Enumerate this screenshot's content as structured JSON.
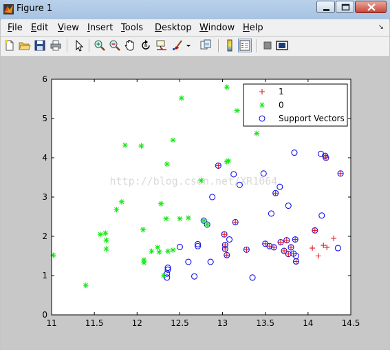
{
  "window": {
    "title": "Figure 1",
    "controls": {
      "minimize": "minimize",
      "maximize": "maximize",
      "close": "close"
    }
  },
  "menu": {
    "items": [
      {
        "label": "File",
        "mnemonic": "F"
      },
      {
        "label": "Edit",
        "mnemonic": "E"
      },
      {
        "label": "View",
        "mnemonic": "V"
      },
      {
        "label": "Insert",
        "mnemonic": "I"
      },
      {
        "label": "Tools",
        "mnemonic": "T"
      },
      {
        "label": "Desktop",
        "mnemonic": "D"
      },
      {
        "label": "Window",
        "mnemonic": "W"
      },
      {
        "label": "Help",
        "mnemonic": "H"
      }
    ],
    "dock_icon": "↘"
  },
  "toolbar": {
    "icons": [
      "new-figure-icon",
      "open-file-icon",
      "save-icon",
      "print-icon",
      "edit-plot-icon",
      "zoom-in-icon",
      "zoom-out-icon",
      "pan-icon",
      "rotate-3d-icon",
      "data-cursor-icon",
      "brush-icon",
      "brush-dropdown-icon",
      "link-plot-icon",
      "insert-colorbar-icon",
      "insert-legend-icon",
      "hide-plot-tools-icon",
      "show-plot-tools-icon"
    ]
  },
  "watermark": "http://blog.csdn.net/XR1064",
  "chart_data": {
    "type": "scatter",
    "xlim": [
      11,
      14.5
    ],
    "ylim": [
      0,
      6
    ],
    "xticks": [
      "11",
      "11.5",
      "12",
      "12.5",
      "13",
      "13.5",
      "14",
      "14.5"
    ],
    "yticks": [
      "0",
      "1",
      "2",
      "3",
      "4",
      "5",
      "6"
    ],
    "grid": false,
    "legend_placement": "top-right",
    "series": [
      {
        "name": "1",
        "marker": "plus",
        "color": "#e8141b",
        "points": [
          [
            12.95,
            3.8
          ],
          [
            13.02,
            2.05
          ],
          [
            13.03,
            1.78
          ],
          [
            13.03,
            1.68
          ],
          [
            13.05,
            1.52
          ],
          [
            13.15,
            2.36
          ],
          [
            13.28,
            1.66
          ],
          [
            13.5,
            1.81
          ],
          [
            13.55,
            1.75
          ],
          [
            13.6,
            1.72
          ],
          [
            13.62,
            3.1
          ],
          [
            13.68,
            1.85
          ],
          [
            13.72,
            1.63
          ],
          [
            13.75,
            1.9
          ],
          [
            13.77,
            1.55
          ],
          [
            13.8,
            1.72
          ],
          [
            13.83,
            1.56
          ],
          [
            13.85,
            1.92
          ],
          [
            13.86,
            1.36
          ],
          [
            14.05,
            1.7
          ],
          [
            14.08,
            2.15
          ],
          [
            14.12,
            1.5
          ],
          [
            14.18,
            1.77
          ],
          [
            14.2,
            4.05
          ],
          [
            14.22,
            1.72
          ],
          [
            14.3,
            1.95
          ],
          [
            14.38,
            3.6
          ],
          [
            14.21,
            4.0
          ]
        ]
      },
      {
        "name": "0",
        "marker": "star",
        "color": "#18e818",
        "points": [
          [
            11.02,
            1.52
          ],
          [
            11.4,
            0.75
          ],
          [
            11.57,
            2.05
          ],
          [
            11.63,
            2.08
          ],
          [
            11.64,
            1.9
          ],
          [
            11.64,
            1.68
          ],
          [
            11.76,
            2.68
          ],
          [
            11.82,
            2.88
          ],
          [
            11.86,
            4.32
          ],
          [
            12.05,
            4.3
          ],
          [
            12.07,
            2.17
          ],
          [
            12.08,
            1.4
          ],
          [
            12.08,
            1.33
          ],
          [
            12.17,
            1.62
          ],
          [
            12.24,
            1.72
          ],
          [
            12.26,
            1.6
          ],
          [
            12.28,
            2.83
          ],
          [
            12.31,
            1.0
          ],
          [
            12.34,
            2.45
          ],
          [
            12.35,
            3.84
          ],
          [
            12.36,
            1.62
          ],
          [
            12.42,
            4.45
          ],
          [
            12.42,
            1.65
          ],
          [
            12.5,
            2.45
          ],
          [
            12.52,
            5.52
          ],
          [
            12.6,
            2.47
          ],
          [
            12.75,
            3.42
          ],
          [
            12.78,
            2.4
          ],
          [
            12.82,
            2.3
          ],
          [
            13.05,
            5.8
          ],
          [
            13.05,
            3.9
          ],
          [
            13.07,
            3.92
          ],
          [
            13.17,
            5.2
          ],
          [
            13.4,
            4.62
          ]
        ]
      },
      {
        "name": "Support Vectors",
        "marker": "circle",
        "color": "#1010f0",
        "points": [
          [
            12.35,
            0.95
          ],
          [
            12.35,
            1.05
          ],
          [
            12.36,
            1.15
          ],
          [
            12.36,
            1.2
          ],
          [
            12.5,
            1.73
          ],
          [
            12.6,
            1.35
          ],
          [
            12.67,
            0.98
          ],
          [
            12.71,
            1.8
          ],
          [
            12.71,
            1.75
          ],
          [
            12.78,
            2.4
          ],
          [
            12.82,
            2.3
          ],
          [
            12.86,
            1.35
          ],
          [
            12.88,
            3.0
          ],
          [
            12.95,
            3.8
          ],
          [
            13.02,
            2.05
          ],
          [
            13.03,
            1.78
          ],
          [
            13.03,
            1.68
          ],
          [
            13.05,
            1.52
          ],
          [
            13.08,
            1.92
          ],
          [
            13.13,
            3.58
          ],
          [
            13.15,
            2.36
          ],
          [
            13.2,
            3.31
          ],
          [
            13.28,
            1.66
          ],
          [
            13.35,
            0.95
          ],
          [
            13.48,
            3.6
          ],
          [
            13.5,
            1.81
          ],
          [
            13.55,
            1.75
          ],
          [
            13.57,
            2.58
          ],
          [
            13.6,
            1.72
          ],
          [
            13.62,
            3.1
          ],
          [
            13.67,
            3.26
          ],
          [
            13.68,
            1.85
          ],
          [
            13.72,
            1.63
          ],
          [
            13.75,
            1.9
          ],
          [
            13.77,
            1.55
          ],
          [
            13.77,
            2.78
          ],
          [
            13.8,
            1.72
          ],
          [
            13.83,
            1.56
          ],
          [
            13.84,
            4.13
          ],
          [
            13.85,
            1.92
          ],
          [
            13.86,
            1.36
          ],
          [
            13.86,
            1.5
          ],
          [
            14.08,
            2.15
          ],
          [
            14.15,
            4.1
          ],
          [
            14.16,
            2.53
          ],
          [
            14.2,
            4.05
          ],
          [
            14.21,
            4.0
          ],
          [
            14.35,
            1.7
          ],
          [
            14.38,
            3.6
          ]
        ]
      }
    ]
  }
}
